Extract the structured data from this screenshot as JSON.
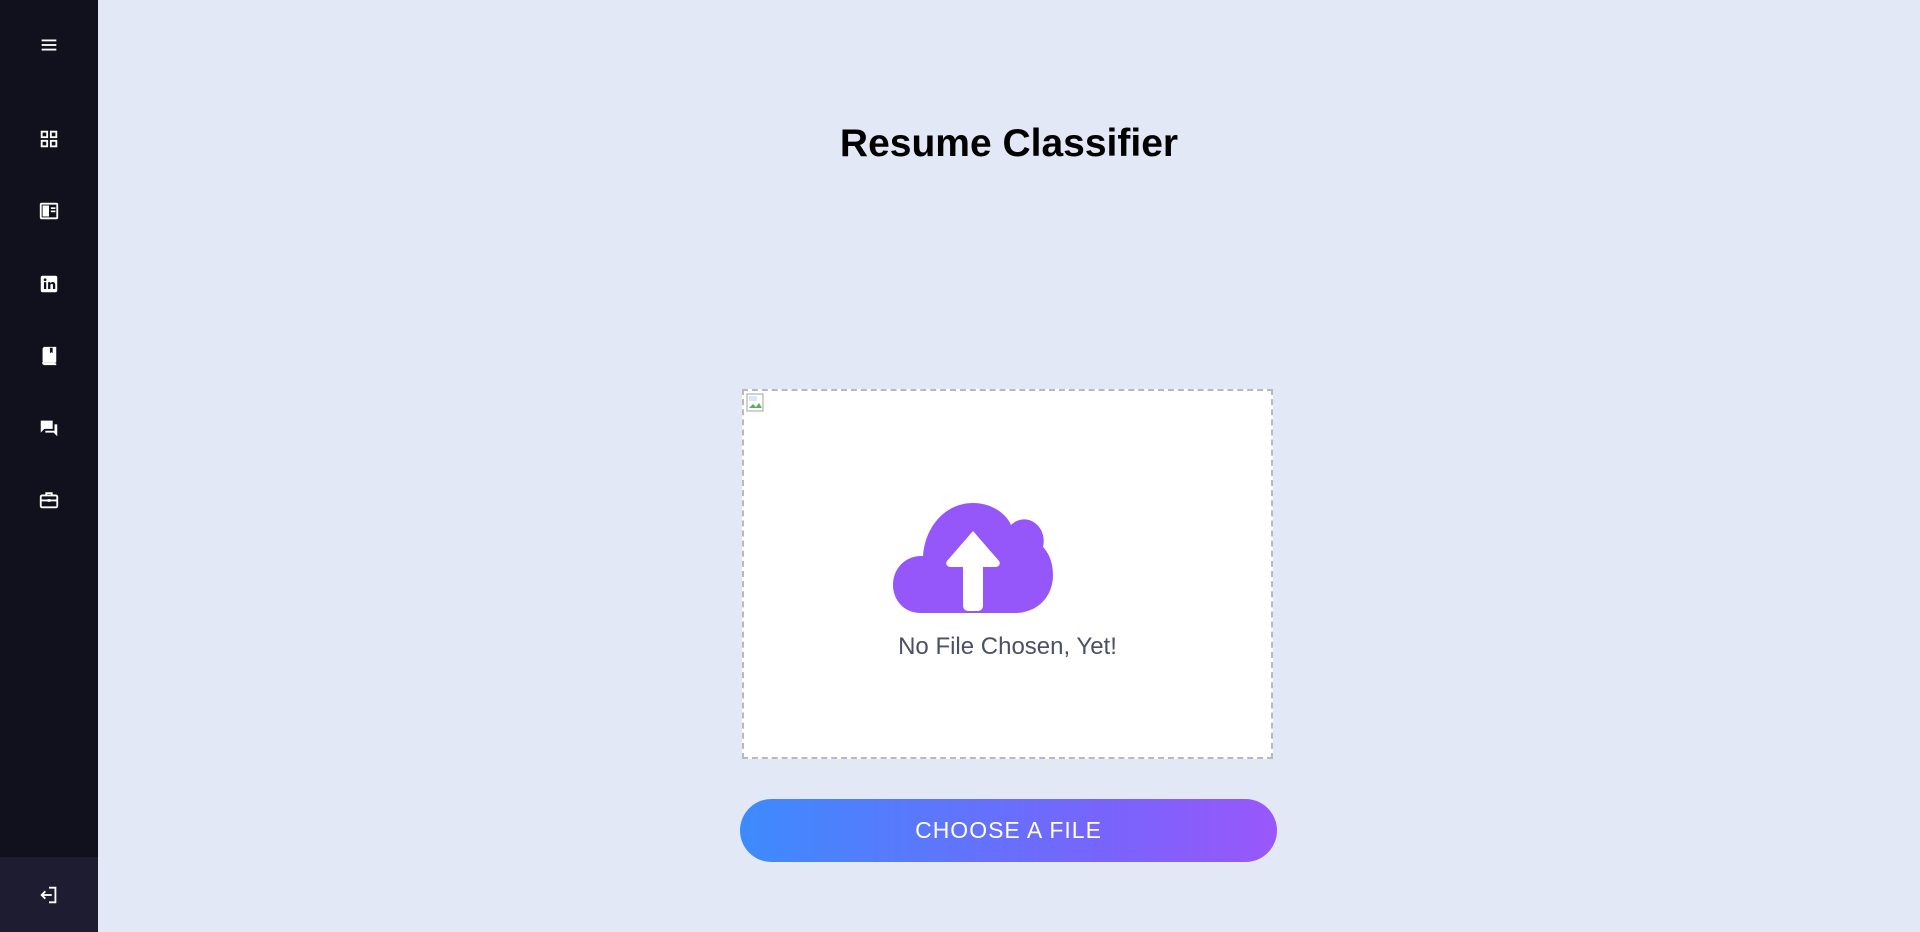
{
  "page": {
    "title": "Resume Classifier"
  },
  "sidebar": {
    "menu_icon": "hamburger-menu-icon",
    "items": [
      {
        "name": "dashboard",
        "icon": "grid-icon"
      },
      {
        "name": "resume",
        "icon": "resume-card-icon"
      },
      {
        "name": "linkedin",
        "icon": "linkedin-icon"
      },
      {
        "name": "library",
        "icon": "book-icon"
      },
      {
        "name": "messages",
        "icon": "chat-icon"
      },
      {
        "name": "jobs",
        "icon": "briefcase-icon"
      }
    ],
    "logout_icon": "logout-icon"
  },
  "upload": {
    "status_text": "No File Chosen, Yet!",
    "button_label": "CHOOSE A FILE",
    "icon": "cloud-upload-icon"
  },
  "colors": {
    "sidebar_bg": "#11111e",
    "page_bg": "#e3e8f7",
    "accent_purple": "#9557f9",
    "button_gradient_start": "#3d8bfd",
    "button_gradient_end": "#9a57fb"
  }
}
